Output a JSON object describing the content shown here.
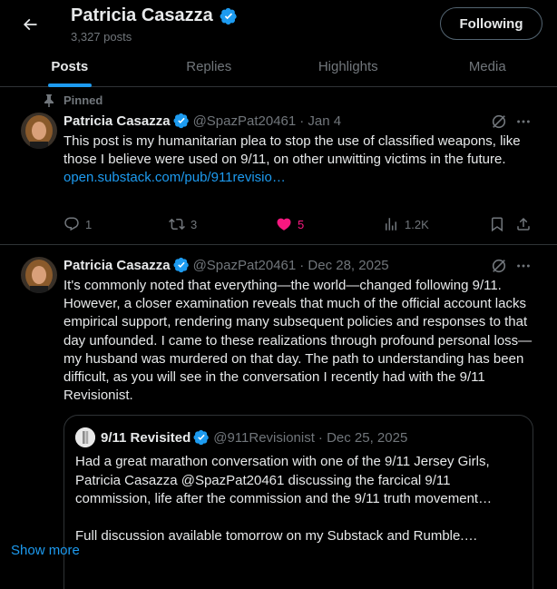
{
  "header": {
    "name": "Patricia Casazza",
    "post_count": "3,327 posts",
    "follow_label": "Following"
  },
  "tabs": [
    {
      "label": "Posts",
      "active": true
    },
    {
      "label": "Replies",
      "active": false
    },
    {
      "label": "Highlights",
      "active": false
    },
    {
      "label": "Media",
      "active": false
    }
  ],
  "pinned_label": "Pinned",
  "posts": [
    {
      "name": "Patricia Casazza",
      "handle": "@SpazPat20461",
      "date": "· Jan 4",
      "text": "This post is my humanitarian plea to stop the use of classified weapons, like those I believe were used on 9/11, on other unwitting victims in the future.",
      "link": "open.substack.com/pub/911revisio…",
      "replies": "1",
      "reposts": "3",
      "likes": "5",
      "views": "1.2K"
    },
    {
      "name": "Patricia Casazza",
      "handle": "@SpazPat20461",
      "date": "· Dec 28, 2025",
      "text": "It's commonly noted that everything—the world—changed following 9/11. However, a closer examination reveals that much of the official account lacks empirical support, rendering many subsequent policies and responses to that day unfounded. I came to these realizations through profound personal loss—my husband was murdered on that day. The path to understanding has been difficult, as you will see in the conversation I recently had with the 9/11 Revisionist."
    }
  ],
  "quote": {
    "name": "9/11 Revisited",
    "handle": "@911Revisionist",
    "date": "· Dec 25, 2025",
    "text1": "Had a great marathon conversation with one of the 9/11 Jersey Girls, Patricia Casazza @SpazPat20461 discussing the farcical 9/11 commission, life after the commission and the 9/11 truth movement…",
    "text2": "Full discussion available tomorrow on my Substack and Rumble.…",
    "show_more": "Show more"
  },
  "colors": {
    "accent": "#1d9bf0",
    "like": "#f91880",
    "muted": "#71767b",
    "border": "#2f3336"
  }
}
